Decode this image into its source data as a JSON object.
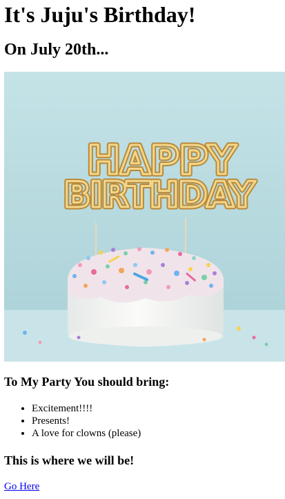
{
  "page": {
    "title": "It's Juju's Birthday!",
    "subtitle": "On July 20th..."
  },
  "photo": {
    "cake_topper_text": [
      "HAPPY",
      "BIRTHDAY"
    ],
    "colors": {
      "background": "#b9dbe0",
      "table": "#c7e2e6",
      "frosting": "#f4f4f1",
      "topper_gold": "#d2ad5c"
    }
  },
  "bring": {
    "heading": "To My Party You should bring:",
    "items": [
      "Excitement!!!!",
      "Presents!",
      "A love for clowns (please)"
    ]
  },
  "location": {
    "heading": "This is where we will be!",
    "link_label": "Go Here",
    "link_color": "#0000ee"
  }
}
